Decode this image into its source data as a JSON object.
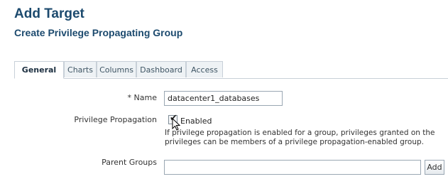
{
  "header": {
    "title": "Add Target",
    "subtitle": "Create Privilege Propagating Group"
  },
  "tabs": [
    {
      "label": "General",
      "active": true
    },
    {
      "label": "Charts",
      "active": false
    },
    {
      "label": "Columns",
      "active": false
    },
    {
      "label": "Dashboard",
      "active": false
    },
    {
      "label": "Access",
      "active": false
    }
  ],
  "form": {
    "name": {
      "required_marker": "*",
      "label": "Name",
      "value": "datacenter1_databases"
    },
    "privilege_propagation": {
      "label": "Privilege Propagation",
      "checked": true,
      "checkbox_label": "Enabled",
      "help_line1": "If privilege propagation is enabled for a group, privileges granted on the",
      "help_line2": "privileges can be members of a privilege propagation-enabled group."
    },
    "parent_groups": {
      "label": "Parent Groups",
      "value": "",
      "add_label": "Add"
    }
  },
  "icons": {
    "check": "checkmark-icon",
    "cursor": "mouse-pointer-icon"
  },
  "colors": {
    "title": "#1c4a6e",
    "tab_inactive_bg": "#eef2f5",
    "border": "#c8d0d8"
  }
}
